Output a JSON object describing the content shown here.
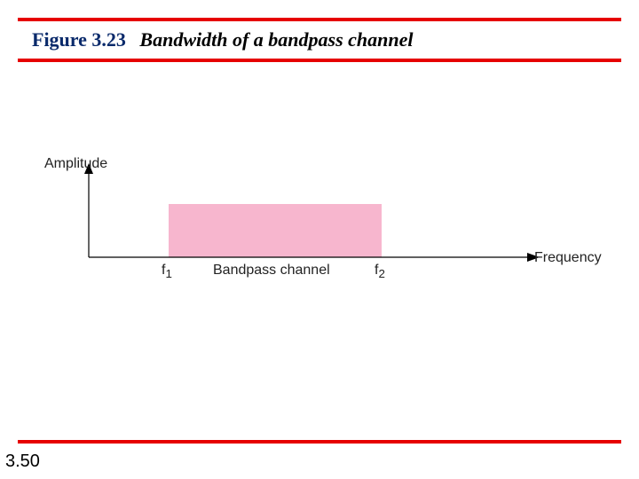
{
  "header": {
    "figure_label": "Figure 3.23",
    "caption": "Bandwidth of a bandpass channel"
  },
  "diagram": {
    "y_axis_label": "Amplitude",
    "x_axis_label": "Frequency",
    "f1_label": "f",
    "f1_sub": "1",
    "f2_label": "f",
    "f2_sub": "2",
    "band_label": "Bandpass channel"
  },
  "footer": {
    "page_number": "3.50"
  },
  "colors": {
    "rule": "#e60000",
    "band_fill": "#f7b6ce",
    "title_blue": "#0a2a6b"
  }
}
